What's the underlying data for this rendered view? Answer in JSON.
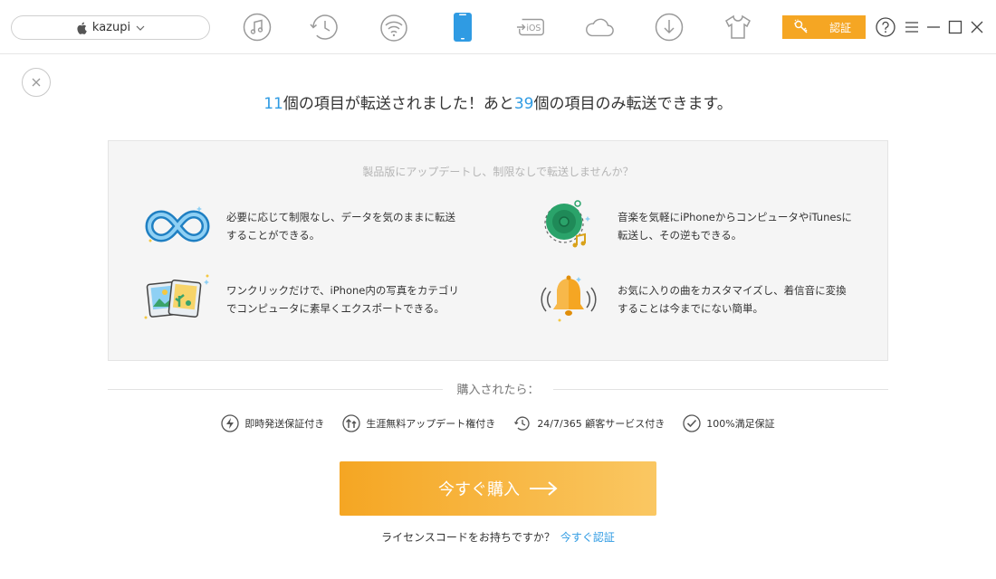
{
  "device": {
    "name": "kazupi",
    "apple_icon": "apple-icon",
    "chevron_icon": "chevron-down-icon"
  },
  "nav": [
    {
      "name": "music-icon"
    },
    {
      "name": "history-icon"
    },
    {
      "name": "wifi-icon"
    },
    {
      "name": "iphone-icon",
      "active": true
    },
    {
      "name": "ios-update-icon",
      "label": "iOS"
    },
    {
      "name": "cloud-icon"
    },
    {
      "name": "download-icon"
    },
    {
      "name": "tshirt-icon"
    }
  ],
  "activate_button": {
    "label": "認証",
    "icon": "key-icon"
  },
  "window": {
    "help": "help-icon",
    "menu": "menu-icon",
    "minimize": "minimize-icon",
    "maximize": "maximize-icon",
    "close": "close-icon"
  },
  "headline": {
    "transferred_count": "11",
    "part1": "個の項目が転送されました！あと",
    "remaining_count": "39",
    "part2": "個の項目のみ転送できます。"
  },
  "panel": {
    "subtitle": "製品版にアップデートし、制限なしで転送しませんか？",
    "features": [
      {
        "icon": "infinity-icon",
        "text": "必要に応じて制限なし、データを気のままに転送することができる。"
      },
      {
        "icon": "music-disc-icon",
        "text": "音楽を気軽にiPhoneからコンピュータやiTunesに転送し、その逆もできる。"
      },
      {
        "icon": "photos-icon",
        "text": "ワンクリックだけで、iPhone内の写真をカテゴリでコンピュータに素早くエクスポートできる。"
      },
      {
        "icon": "ringtone-bell-icon",
        "text": "お気に入りの曲をカスタマイズし、着信音に変換することは今までにない簡単。"
      }
    ]
  },
  "purchase": {
    "divider_label": "購入されたら：",
    "benefits": [
      {
        "icon": "lightning-icon",
        "text": "即時発送保証付き"
      },
      {
        "icon": "update-arrows-icon",
        "text": "生涯無料アップデート権付き"
      },
      {
        "icon": "clock-icon",
        "text": "24/7/365 顧客サービス付き"
      },
      {
        "icon": "checkmark-icon",
        "text": "100%満足保証"
      }
    ],
    "buy_button": "今すぐ購入",
    "license_question": "ライセンスコードをお持ちですか？",
    "license_link": "今すぐ認証"
  },
  "colors": {
    "accent": "#f5a623",
    "link": "#2f9be3",
    "active_nav": "#2f9be3"
  }
}
